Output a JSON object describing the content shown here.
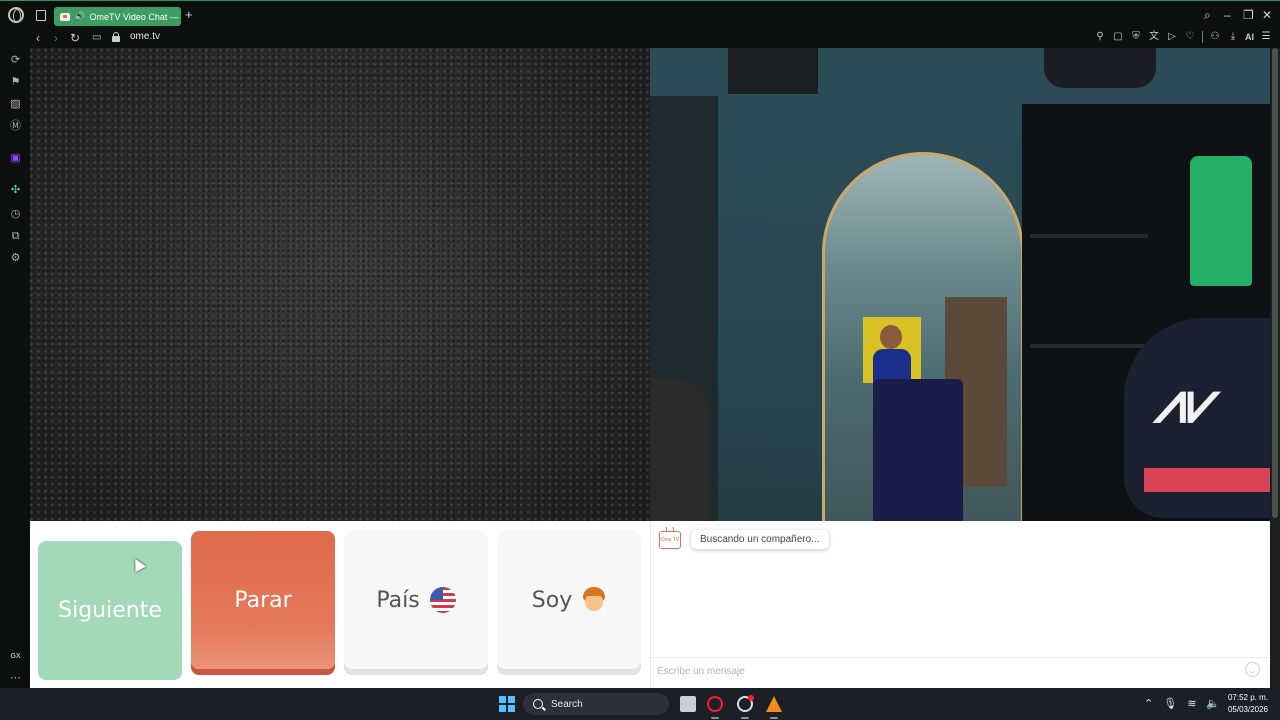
{
  "browser": {
    "tab_title": "OmeTV Video Chat —",
    "url": "ome.tv",
    "new_tab": "+",
    "ai_label": "AI",
    "gx_label": "GX"
  },
  "buttons": {
    "next": "Siguiente",
    "stop": "Parar",
    "country": "País",
    "gender": "Soy"
  },
  "chat": {
    "logo_text": "Ome TV",
    "status": "Buscando un compañero...",
    "input_placeholder": "Escribe un mensaje"
  },
  "taskbar": {
    "search_label": "Search",
    "time": "07:52 p. m.",
    "date": "05/03/2026"
  },
  "colors": {
    "accent": "#3d9d60",
    "next_button": "#a3d8b9",
    "stop_button": "#e06a4c",
    "neutral_button": "#f7f7f7"
  },
  "icons": {
    "country_flag": "us-flag-icon",
    "gender_avatar": "boy-emoji-icon"
  }
}
